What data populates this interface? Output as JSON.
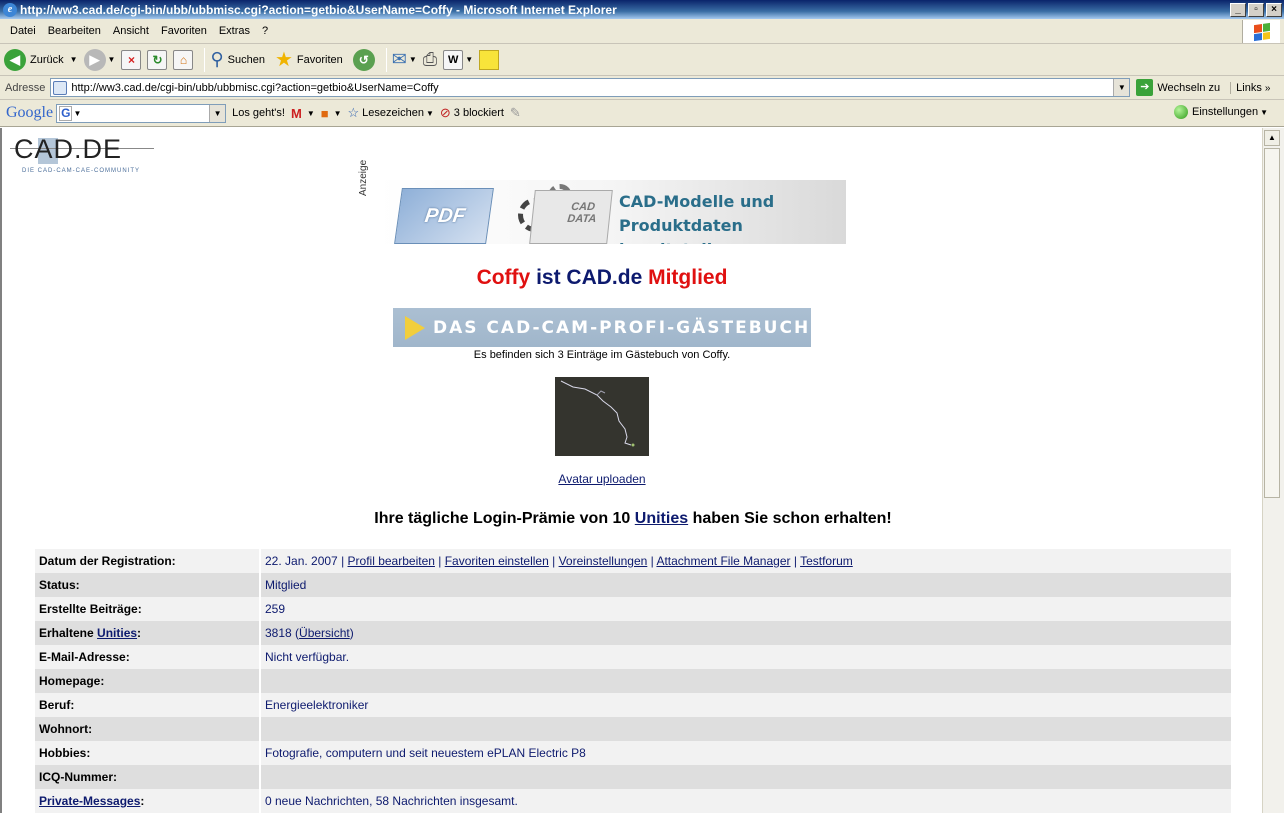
{
  "window": {
    "title": "http://ww3.cad.de/cgi-bin/ubb/ubbmisc.cgi?action=getbio&UserName=Coffy - Microsoft Internet Explorer",
    "btn_min": "_",
    "btn_max": "▫",
    "btn_close": "×"
  },
  "menu": {
    "datei": "Datei",
    "bearbeiten": "Bearbeiten",
    "ansicht": "Ansicht",
    "favoriten": "Favoriten",
    "extras": "Extras",
    "help": "?"
  },
  "toolbar": {
    "back": "Zurück",
    "search": "Suchen",
    "favorites": "Favoriten"
  },
  "address": {
    "label": "Adresse",
    "url": "http://ww3.cad.de/cgi-bin/ubb/ubbmisc.cgi?action=getbio&UserName=Coffy",
    "go": "Wechseln zu",
    "links": "Links"
  },
  "google": {
    "logo": "Google",
    "search_go": "Los geht's!",
    "bookmarks": "Lesezeichen",
    "blocked": "3 blockiert",
    "settings": "Einstellungen"
  },
  "page": {
    "logo_word": "CAD.DE",
    "logo_tagline": "DIE CAD-CAM-CAE-COMMUNITY",
    "ad_label": "Anzeige",
    "ad_doc1": "PDF",
    "ad_doc2": "CAD DATA",
    "ad_text_1": "CAD-Modelle und",
    "ad_text_2": "Produktdaten bereitstellen...",
    "headline_user": "Coffy",
    "headline_mid": " ist ",
    "headline_site": "CAD.de",
    "headline_end": " Mitglied",
    "guestbook_banner": "DAS CAD-CAM-PROFI-GÄSTEBUCH",
    "guestbook_note": "Es befinden sich 3 Einträge im Gästebuch von Coffy.",
    "avatar_upload": "Avatar uploaden",
    "login_pre": "Ihre tägliche Login-Prämie von 10 ",
    "login_link": "Unities",
    "login_post": " haben Sie schon erhalten!"
  },
  "profile": {
    "reg_label": "Datum der Registration:",
    "reg_date": "22. Jan. 2007",
    "sep": " | ",
    "link_profil": "Profil bearbeiten",
    "link_favoriten": "Favoriten einstellen",
    "link_voreinst": "Voreinstellungen",
    "link_attach": "Attachment File Manager",
    "link_testforum": "Testforum",
    "status_label": "Status:",
    "status_value": "Mitglied",
    "posts_label": "Erstellte Beiträge:",
    "posts_value": "259",
    "unities_label_pre": "Erhaltene ",
    "unities_label_link": "Unities",
    "unities_label_post": ":",
    "unities_value": "3818",
    "unities_open": " (",
    "unities_overview": "Übersicht",
    "unities_close": ")",
    "email_label": "E-Mail-Adresse:",
    "email_value": "Nicht verfügbar.",
    "homepage_label": "Homepage:",
    "homepage_value": "",
    "beruf_label": "Beruf:",
    "beruf_value": "Energieelektroniker",
    "wohnort_label": "Wohnort:",
    "wohnort_value": "",
    "hobbies_label": "Hobbies:",
    "hobbies_value": "Fotografie, computern und seit neuestem ePLAN Electric P8",
    "icq_label": "ICQ-Nummer:",
    "icq_value": "",
    "pm_label_link": "Private-Messages",
    "pm_label_post": ":",
    "pm_value": "0 neue Nachrichten, 58 Nachrichten insgesamt."
  },
  "colors": {
    "accent_red": "#e01010",
    "navy": "#0d1a6e",
    "banner_blue": "#a0b6cb"
  }
}
